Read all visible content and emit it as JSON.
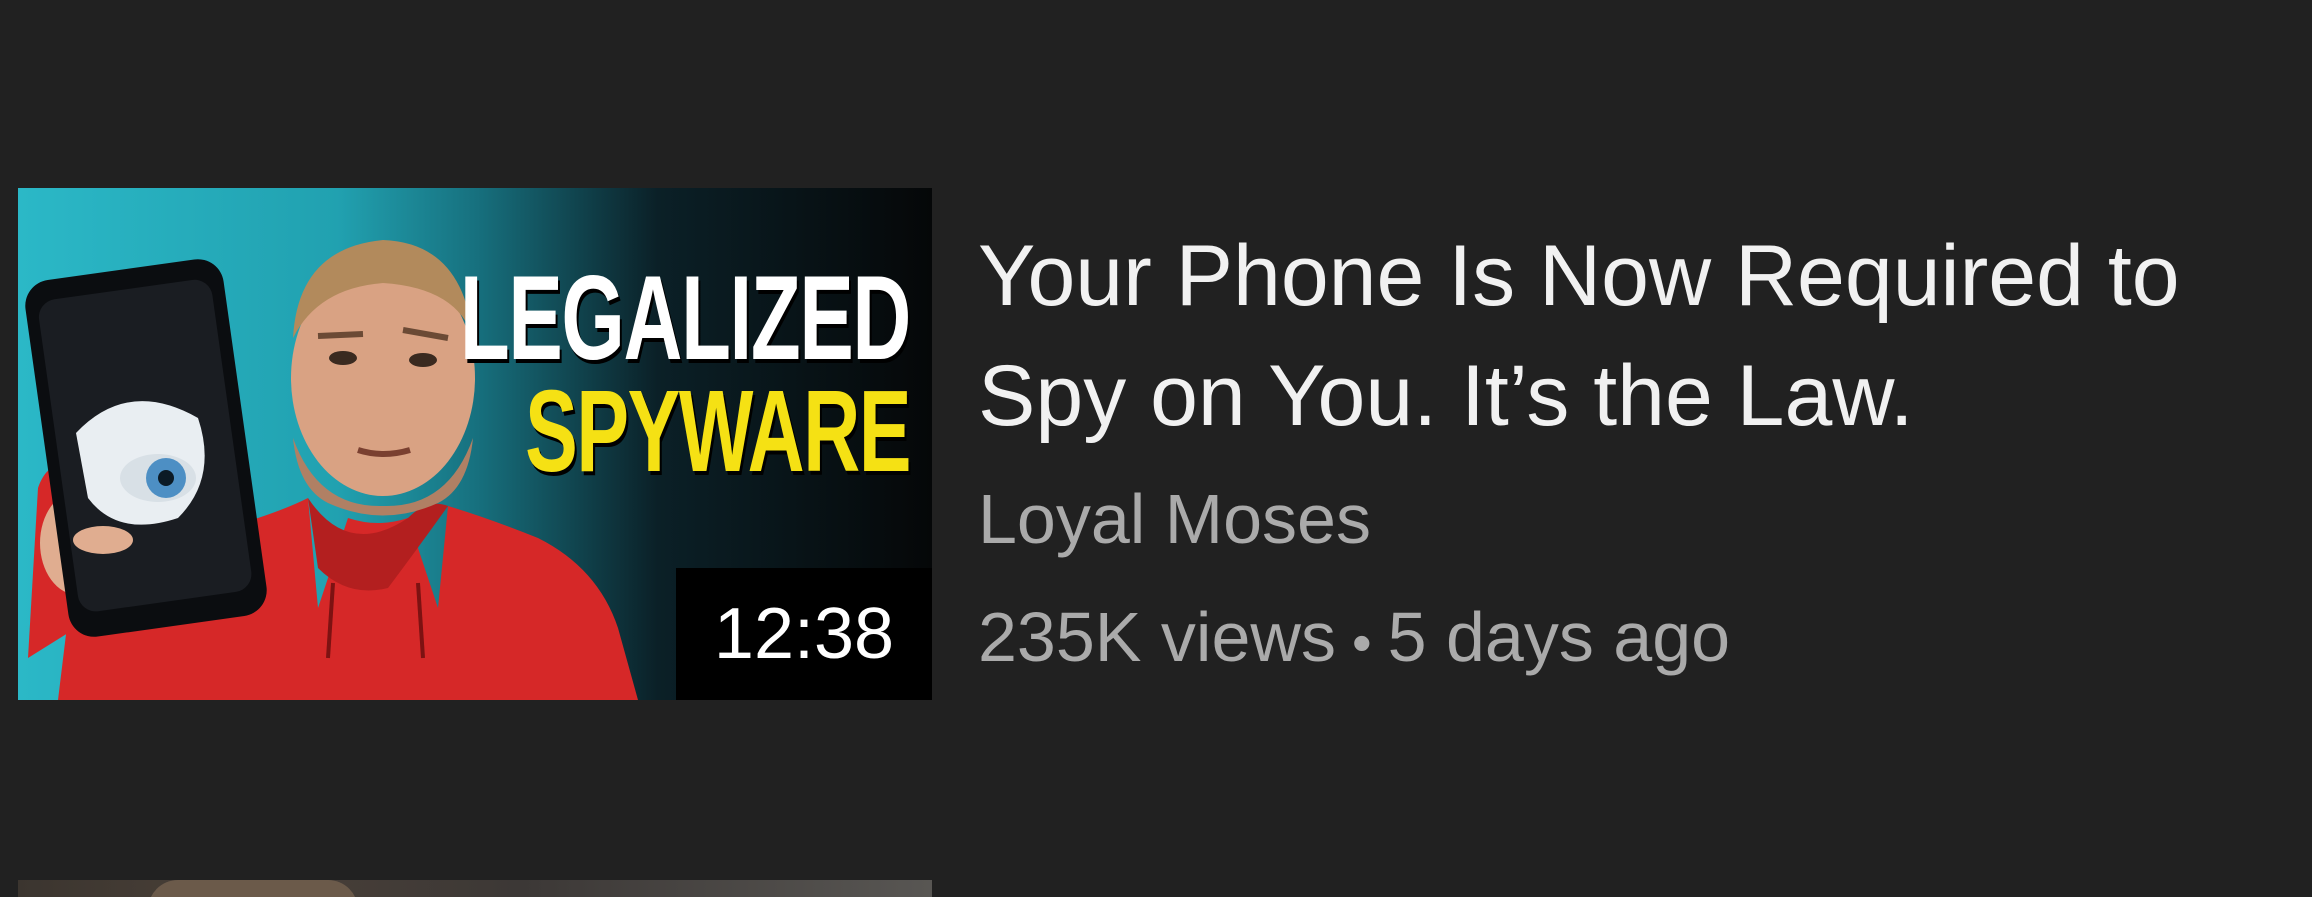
{
  "video": {
    "title": "Your Phone Is Now Required to Spy on You. It’s the Law.",
    "channel": "Loyal Moses",
    "views": "235K views",
    "separator": "•",
    "age": "5 days ago",
    "duration": "12:38",
    "thumbnail": {
      "text_line_1": "LEGALIZED",
      "text_line_2": "SPYWARE"
    }
  },
  "colors": {
    "background": "#212121",
    "title_text": "#f1f1f1",
    "secondary_text": "#aaaaaa",
    "thumbnail_yellow": "#f5e114",
    "hoodie_red": "#d62828"
  }
}
